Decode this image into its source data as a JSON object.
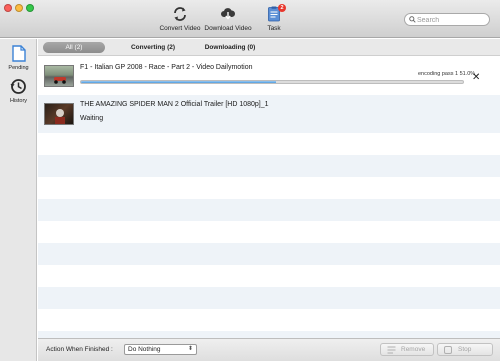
{
  "window": {
    "toolbar": {
      "convert_label": "Convert Video",
      "download_label": "Download Video",
      "task_label": "Task",
      "task_badge": "2"
    },
    "search": {
      "placeholder": "Search",
      "value": ""
    }
  },
  "sidebar": {
    "items": [
      {
        "label": "Pending",
        "icon": "document-icon"
      },
      {
        "label": "History",
        "icon": "history-clock-icon"
      }
    ]
  },
  "tabs": [
    {
      "label": "All (2)",
      "active": true
    },
    {
      "label": "Converting (2)",
      "active": false
    },
    {
      "label": "Downloading (0)",
      "active": false
    }
  ],
  "tasks": [
    {
      "title": "F1 - Italian GP 2008 - Race - Part 2 - Video Dailymotion",
      "status": "encoding pass 1 51.0%",
      "progress": 0.51,
      "thumbnail": "race-car-thumbnail"
    },
    {
      "title": "THE AMAZING SPIDER MAN 2 Official Trailer [HD 1080p]_1",
      "status": "Waiting",
      "thumbnail": "spiderman-thumbnail"
    }
  ],
  "footer": {
    "action_label": "Action When Finished :",
    "action_value": "Do Nothing",
    "remove_label": "Remove",
    "stop_label": "Stop"
  },
  "colors": {
    "accent": "#4f9de0",
    "badge": "#e8372c",
    "row_alt": "#eef3f8"
  }
}
